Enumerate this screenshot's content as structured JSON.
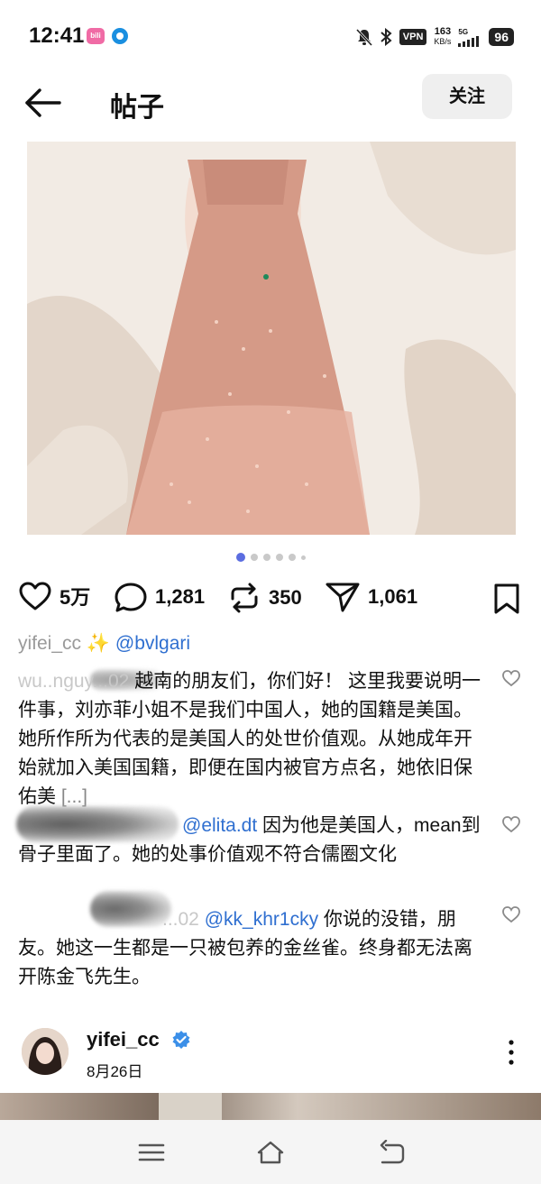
{
  "status_bar": {
    "time": "12:41",
    "app_badge": "bili",
    "vpn": "VPN",
    "speed_value": "163",
    "speed_unit": "KB/s",
    "network": "5G",
    "battery": "96"
  },
  "header": {
    "title": "帖子",
    "follow_label": "关注"
  },
  "carousel": {
    "total": 6,
    "active_index": 0
  },
  "actions": {
    "likes": "5万",
    "comments": "1,281",
    "reposts": "350",
    "shares": "1,061"
  },
  "caption": {
    "user": "yifei_cc",
    "sparkle": "✨",
    "mention": "@bvlgari"
  },
  "comments": [
    {
      "user": "wu..nguy...02",
      "line1": "越南的朋友们，你们好！",
      "body": " 这里我要说明一件事，刘亦菲小姐不是我们中国人，她的国籍是美国。她所作所为代表的是美国人的处世价值观。从她成年开始就加入美国国籍，即便在国内被官方点名，她依旧保佑美",
      "more": "[...]"
    },
    {
      "mention": "@elita.dt",
      "body": " 因为他是美国人，mean到骨子里面了。她的处事价值观不符合儒圈文化"
    },
    {
      "user": "...02",
      "mention": "@kk_khr1cky",
      "body": " 你说的没错，朋友。她这一生都是一只被包养的金丝雀。终身都无法离开陈金飞先生。"
    }
  ],
  "author": {
    "name": "yifei_cc",
    "date": "8月26日"
  },
  "colors": {
    "accent_blue": "#2f6fd0",
    "dot_active": "#5b6de0",
    "verified": "#3b8fe8"
  }
}
